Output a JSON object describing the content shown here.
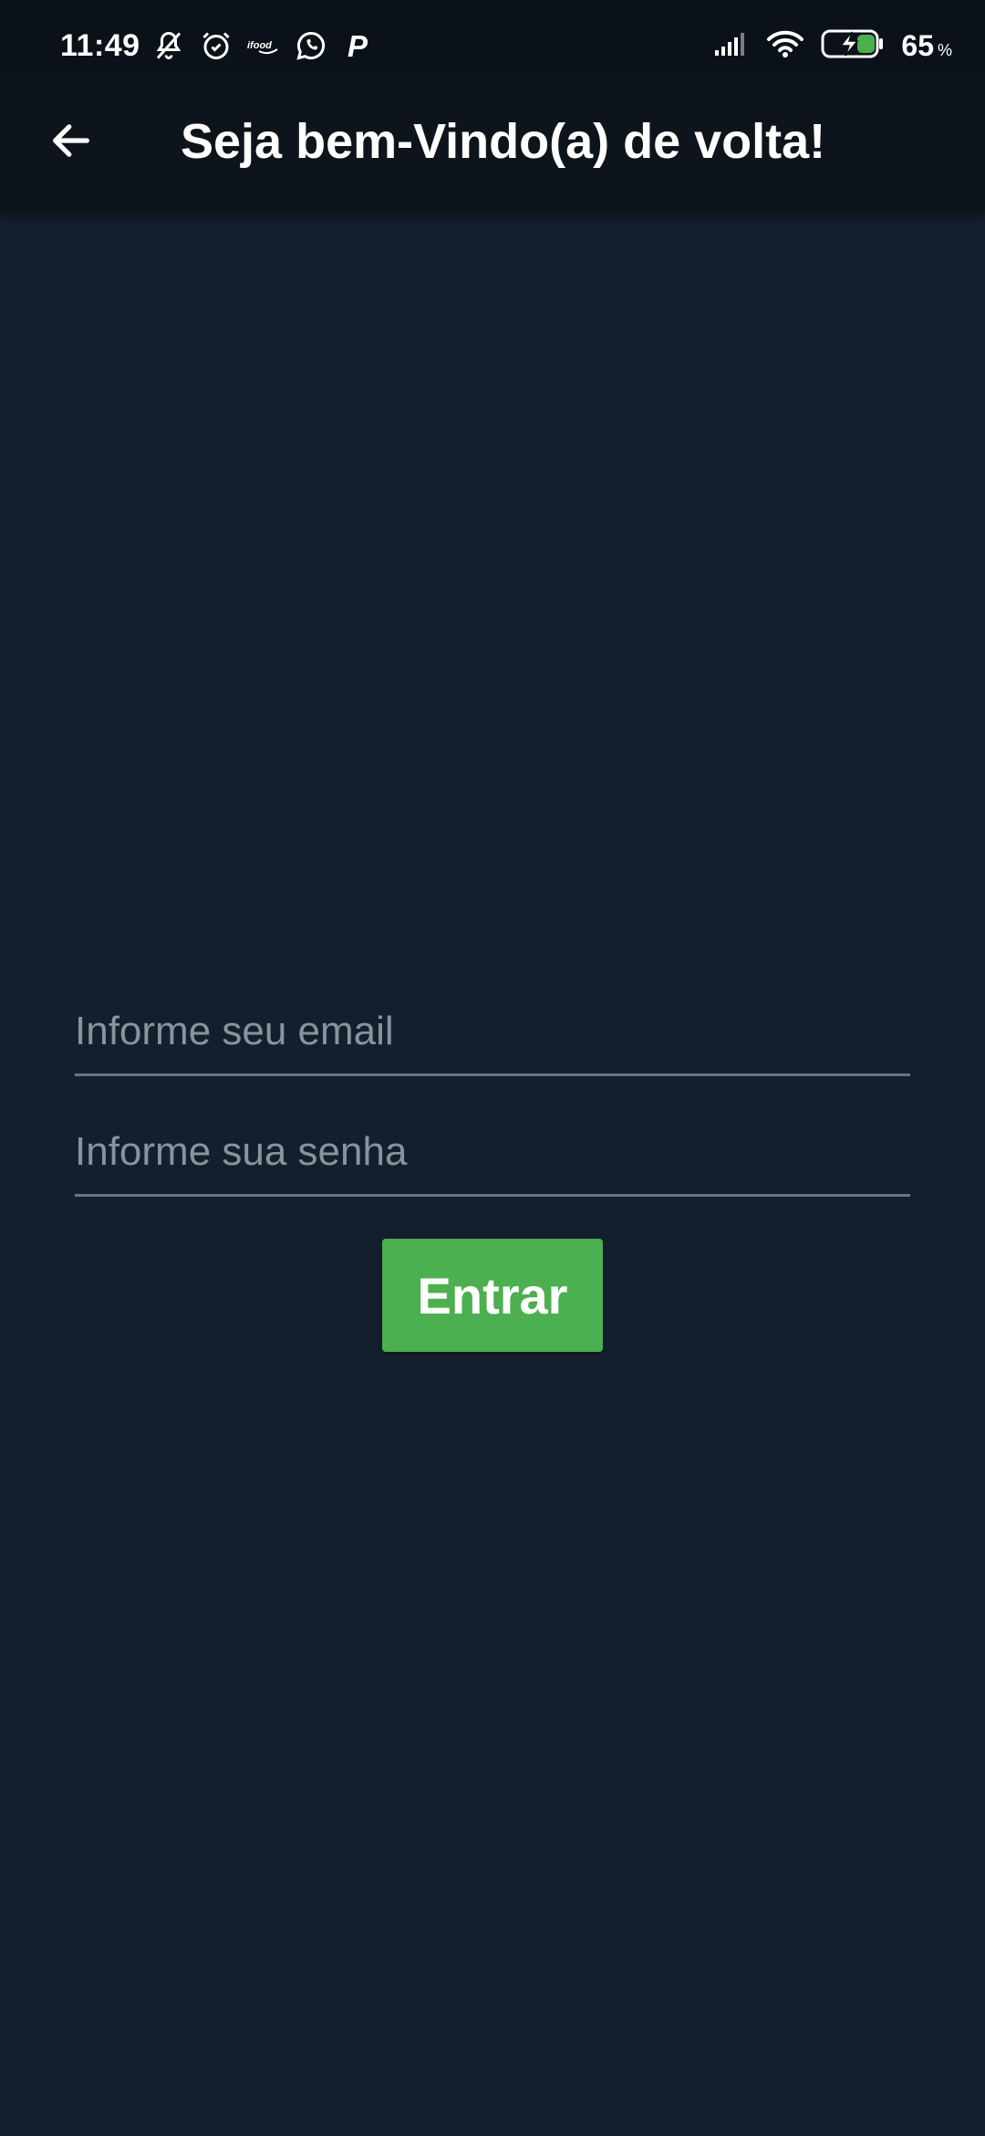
{
  "status_bar": {
    "time": "11:49",
    "left_icons": [
      "bell-off-icon",
      "alarm-icon",
      "ifood-icon",
      "whatsapp-icon",
      "p-app-icon"
    ],
    "ifood_text": "ifood",
    "p_text": "P",
    "battery_percent": "65",
    "battery_unit": "%"
  },
  "app_bar": {
    "title": "Seja bem-Vindo(a) de volta!"
  },
  "form": {
    "email_placeholder": "Informe seu email",
    "email_value": "",
    "password_placeholder": "Informe sua senha",
    "password_value": "",
    "submit_label": "Entrar"
  },
  "colors": {
    "background": "#141f2e",
    "app_bar": "#0d141c",
    "button": "#4caf50",
    "battery_accent": "#4caf50"
  }
}
